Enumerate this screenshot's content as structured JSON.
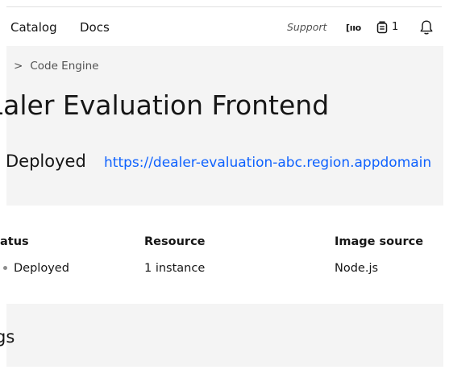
{
  "header": {
    "nav": [
      "Catalog",
      "Docs"
    ],
    "support_label": "Support",
    "switcher_label": "[ııo",
    "cost_count": "1"
  },
  "breadcrumb": {
    "separator": ">",
    "current": "Code Engine"
  },
  "app": {
    "title": "ɩaler Evaluation Frontend",
    "status": "Deployed",
    "url": "https://dealer-evaluation-abc.region.appdomain"
  },
  "details": {
    "status_label": "atus",
    "status_value": "Deployed",
    "resource_label": "Resource",
    "resource_value": "1 instance",
    "image_label": "Image source",
    "image_value": "Node.js"
  },
  "section": {
    "title": "gs"
  },
  "colors": {
    "link": "#0f62fe",
    "panel": "#f4f4f4",
    "text": "#161616",
    "muted": "#525252"
  },
  "icons": [
    "app-switcher-icon",
    "cost-estimator-icon",
    "notification-bell-icon",
    "chevron-right-icon"
  ]
}
